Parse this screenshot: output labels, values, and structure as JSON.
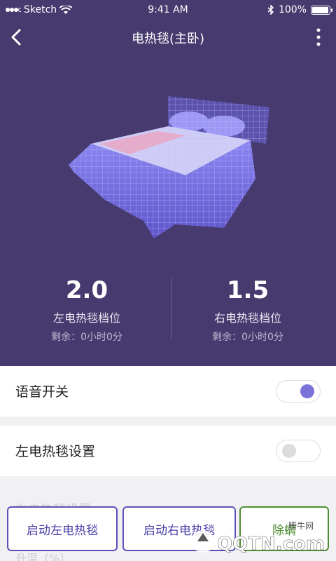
{
  "status_bar": {
    "carrier": "Sketch",
    "time": "9:41 AM",
    "battery": "100%",
    "battery_level": 1.0
  },
  "nav": {
    "title": "电热毯(主卧)",
    "back_icon": "chevron-left-icon",
    "more_icon": "more-vertical-icon"
  },
  "stats": {
    "left": {
      "value": "2.0",
      "label": "左电热毯档位",
      "remaining": "剩余：0小时0分"
    },
    "right": {
      "value": "1.5",
      "label": "右电热毯档位",
      "remaining": "剩余：0小时0分"
    }
  },
  "settings": {
    "voice": {
      "label": "语音开关",
      "on": true
    },
    "left_blanket": {
      "label": "左电热毯设置",
      "on": false
    },
    "right_blanket_partial": "右电热毯设置",
    "temp_partial": "升温（%）"
  },
  "buttons": {
    "start_left": "启动左电热毯",
    "start_right": "启动右电热毯",
    "mite": "除螨"
  },
  "watermark": {
    "text": "QQTN.com",
    "sub": "腾牛网"
  },
  "colors": {
    "hero_bg": "#463a6e",
    "accent": "#7a72d8",
    "button_purple": "#5c51b8",
    "button_green": "#4f8e33"
  }
}
